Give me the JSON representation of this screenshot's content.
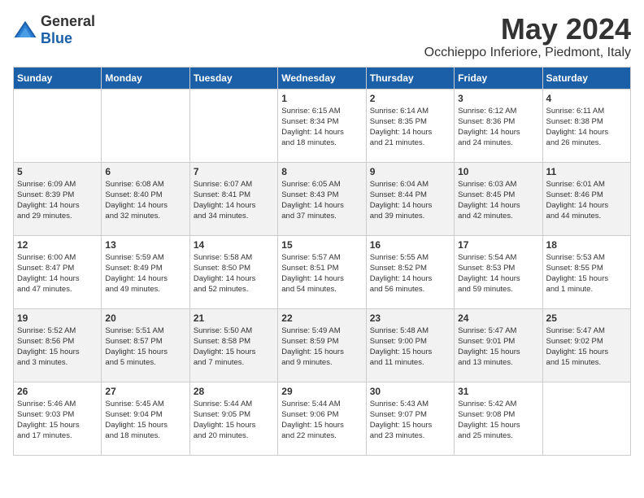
{
  "header": {
    "logo": {
      "general": "General",
      "blue": "Blue"
    },
    "title": "May 2024",
    "subtitle": "Occhieppo Inferiore, Piedmont, Italy"
  },
  "weekdays": [
    "Sunday",
    "Monday",
    "Tuesday",
    "Wednesday",
    "Thursday",
    "Friday",
    "Saturday"
  ],
  "weeks": [
    [
      {
        "day": "",
        "info": ""
      },
      {
        "day": "",
        "info": ""
      },
      {
        "day": "",
        "info": ""
      },
      {
        "day": "1",
        "info": "Sunrise: 6:15 AM\nSunset: 8:34 PM\nDaylight: 14 hours\nand 18 minutes."
      },
      {
        "day": "2",
        "info": "Sunrise: 6:14 AM\nSunset: 8:35 PM\nDaylight: 14 hours\nand 21 minutes."
      },
      {
        "day": "3",
        "info": "Sunrise: 6:12 AM\nSunset: 8:36 PM\nDaylight: 14 hours\nand 24 minutes."
      },
      {
        "day": "4",
        "info": "Sunrise: 6:11 AM\nSunset: 8:38 PM\nDaylight: 14 hours\nand 26 minutes."
      }
    ],
    [
      {
        "day": "5",
        "info": "Sunrise: 6:09 AM\nSunset: 8:39 PM\nDaylight: 14 hours\nand 29 minutes."
      },
      {
        "day": "6",
        "info": "Sunrise: 6:08 AM\nSunset: 8:40 PM\nDaylight: 14 hours\nand 32 minutes."
      },
      {
        "day": "7",
        "info": "Sunrise: 6:07 AM\nSunset: 8:41 PM\nDaylight: 14 hours\nand 34 minutes."
      },
      {
        "day": "8",
        "info": "Sunrise: 6:05 AM\nSunset: 8:43 PM\nDaylight: 14 hours\nand 37 minutes."
      },
      {
        "day": "9",
        "info": "Sunrise: 6:04 AM\nSunset: 8:44 PM\nDaylight: 14 hours\nand 39 minutes."
      },
      {
        "day": "10",
        "info": "Sunrise: 6:03 AM\nSunset: 8:45 PM\nDaylight: 14 hours\nand 42 minutes."
      },
      {
        "day": "11",
        "info": "Sunrise: 6:01 AM\nSunset: 8:46 PM\nDaylight: 14 hours\nand 44 minutes."
      }
    ],
    [
      {
        "day": "12",
        "info": "Sunrise: 6:00 AM\nSunset: 8:47 PM\nDaylight: 14 hours\nand 47 minutes."
      },
      {
        "day": "13",
        "info": "Sunrise: 5:59 AM\nSunset: 8:49 PM\nDaylight: 14 hours\nand 49 minutes."
      },
      {
        "day": "14",
        "info": "Sunrise: 5:58 AM\nSunset: 8:50 PM\nDaylight: 14 hours\nand 52 minutes."
      },
      {
        "day": "15",
        "info": "Sunrise: 5:57 AM\nSunset: 8:51 PM\nDaylight: 14 hours\nand 54 minutes."
      },
      {
        "day": "16",
        "info": "Sunrise: 5:55 AM\nSunset: 8:52 PM\nDaylight: 14 hours\nand 56 minutes."
      },
      {
        "day": "17",
        "info": "Sunrise: 5:54 AM\nSunset: 8:53 PM\nDaylight: 14 hours\nand 59 minutes."
      },
      {
        "day": "18",
        "info": "Sunrise: 5:53 AM\nSunset: 8:55 PM\nDaylight: 15 hours\nand 1 minute."
      }
    ],
    [
      {
        "day": "19",
        "info": "Sunrise: 5:52 AM\nSunset: 8:56 PM\nDaylight: 15 hours\nand 3 minutes."
      },
      {
        "day": "20",
        "info": "Sunrise: 5:51 AM\nSunset: 8:57 PM\nDaylight: 15 hours\nand 5 minutes."
      },
      {
        "day": "21",
        "info": "Sunrise: 5:50 AM\nSunset: 8:58 PM\nDaylight: 15 hours\nand 7 minutes."
      },
      {
        "day": "22",
        "info": "Sunrise: 5:49 AM\nSunset: 8:59 PM\nDaylight: 15 hours\nand 9 minutes."
      },
      {
        "day": "23",
        "info": "Sunrise: 5:48 AM\nSunset: 9:00 PM\nDaylight: 15 hours\nand 11 minutes."
      },
      {
        "day": "24",
        "info": "Sunrise: 5:47 AM\nSunset: 9:01 PM\nDaylight: 15 hours\nand 13 minutes."
      },
      {
        "day": "25",
        "info": "Sunrise: 5:47 AM\nSunset: 9:02 PM\nDaylight: 15 hours\nand 15 minutes."
      }
    ],
    [
      {
        "day": "26",
        "info": "Sunrise: 5:46 AM\nSunset: 9:03 PM\nDaylight: 15 hours\nand 17 minutes."
      },
      {
        "day": "27",
        "info": "Sunrise: 5:45 AM\nSunset: 9:04 PM\nDaylight: 15 hours\nand 18 minutes."
      },
      {
        "day": "28",
        "info": "Sunrise: 5:44 AM\nSunset: 9:05 PM\nDaylight: 15 hours\nand 20 minutes."
      },
      {
        "day": "29",
        "info": "Sunrise: 5:44 AM\nSunset: 9:06 PM\nDaylight: 15 hours\nand 22 minutes."
      },
      {
        "day": "30",
        "info": "Sunrise: 5:43 AM\nSunset: 9:07 PM\nDaylight: 15 hours\nand 23 minutes."
      },
      {
        "day": "31",
        "info": "Sunrise: 5:42 AM\nSunset: 9:08 PM\nDaylight: 15 hours\nand 25 minutes."
      },
      {
        "day": "",
        "info": ""
      }
    ]
  ]
}
